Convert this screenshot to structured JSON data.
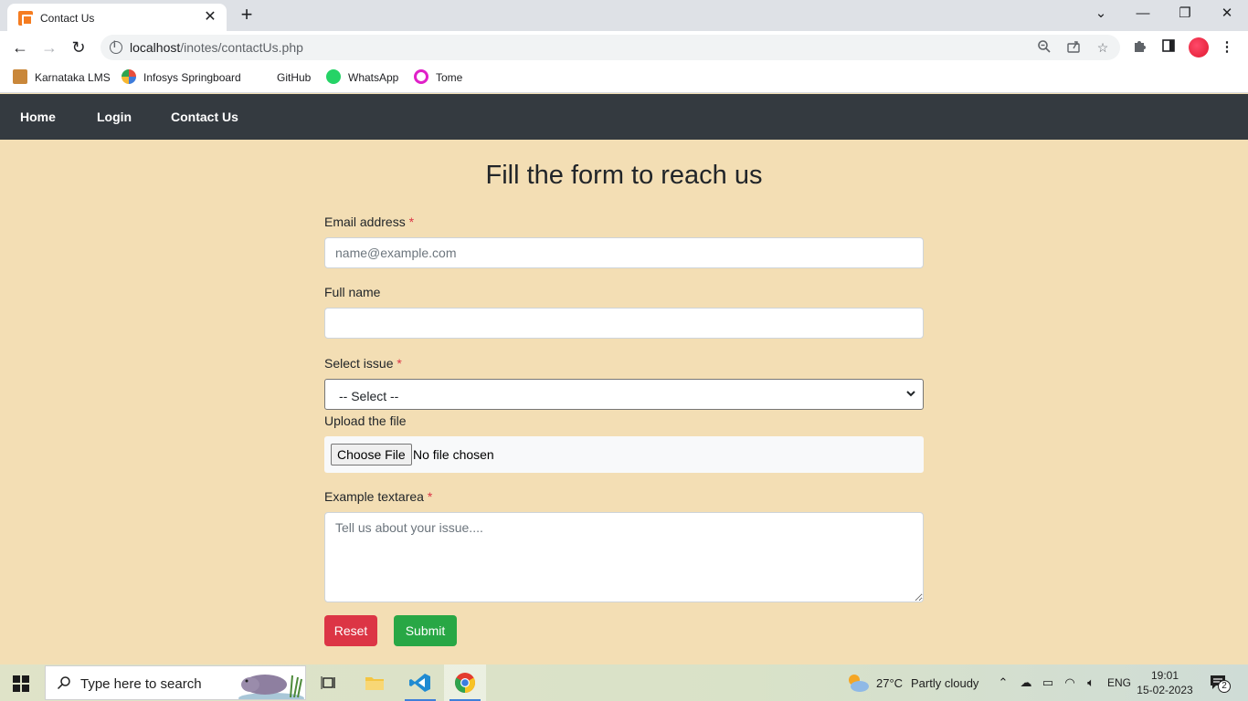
{
  "browser": {
    "tab": {
      "title": "Contact Us",
      "close": "✕"
    },
    "new_tab": "+",
    "window_controls": {
      "tab_search": "⌄",
      "minimize": "—",
      "restore": "❐",
      "close": "✕"
    },
    "address": {
      "host": "localhost",
      "path": "/inotes/contactUs.php"
    },
    "bookmarks": [
      {
        "label": "Karnataka LMS",
        "icon": "karnataka-lms-icon"
      },
      {
        "label": "Infosys Springboard",
        "icon": "infosys-springboard-icon"
      },
      {
        "label": "GitHub",
        "icon": "github-icon"
      },
      {
        "label": "WhatsApp",
        "icon": "whatsapp-icon"
      },
      {
        "label": "Tome",
        "icon": "tome-icon"
      }
    ]
  },
  "navbar": {
    "links": [
      "Home",
      "Login",
      "Contact Us"
    ]
  },
  "form": {
    "title": "Fill the form to reach us",
    "email": {
      "label": "Email address",
      "required": "*",
      "placeholder": "name@example.com",
      "value": ""
    },
    "fullname": {
      "label": "Full name",
      "value": ""
    },
    "issue": {
      "label": "Select issue",
      "required": "*",
      "selected": "-- Select --"
    },
    "upload": {
      "label": "Upload the file",
      "button": "Choose File",
      "status": "No file chosen"
    },
    "textarea": {
      "label": "Example textarea",
      "required": "*",
      "placeholder": "Tell us about your issue...."
    },
    "reset_label": "Reset",
    "submit_label": "Submit",
    "colors": {
      "reset": "#dc3545",
      "submit": "#28a745",
      "navbar": "#343a40",
      "background": "#f3deb4"
    }
  },
  "taskbar": {
    "search_placeholder": "Type here to search",
    "weather": {
      "temp": "27°C",
      "condition": "Partly cloudy"
    },
    "language": "ENG",
    "time": "19:01",
    "date": "15-02-2023",
    "notification_count": "2"
  }
}
